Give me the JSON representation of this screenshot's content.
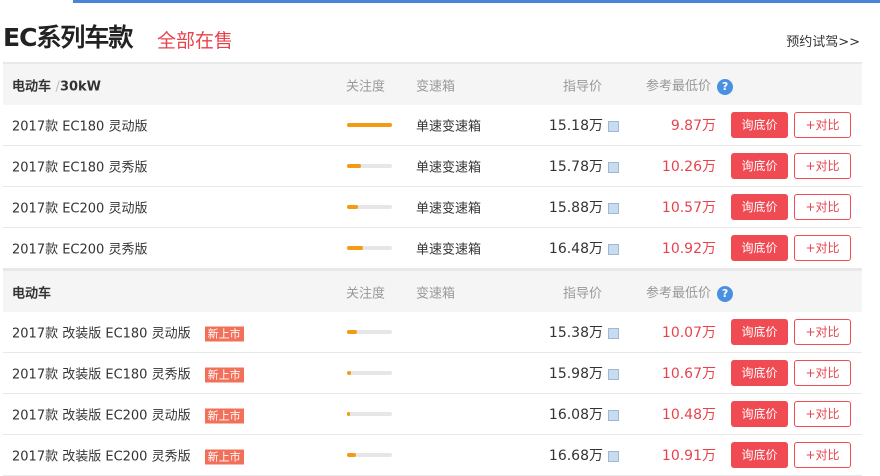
{
  "title": "EC系列车款",
  "tab": "全部在售",
  "test_drive": "预约试驾>>",
  "columns": {
    "attention": "关注度",
    "gearbox": "变速箱",
    "guide_price": "指导价",
    "lowest_price": "参考最低价",
    "help_icon": "?"
  },
  "buttons": {
    "inquire": "询底价",
    "compare": "+对比"
  },
  "badge_new": "新上市",
  "sections": [
    {
      "name": "电动车",
      "sep": "/",
      "power": "30kW",
      "rows": [
        {
          "name": "2017款 EC180 灵动版",
          "attention": 1.0,
          "gearbox": "单速变速箱",
          "guide": "15.18万",
          "low": "9.87万",
          "new": false
        },
        {
          "name": "2017款 EC180 灵秀版",
          "attention": 0.3,
          "gearbox": "单速变速箱",
          "guide": "15.78万",
          "low": "10.26万",
          "new": false
        },
        {
          "name": "2017款 EC200 灵动版",
          "attention": 0.25,
          "gearbox": "单速变速箱",
          "guide": "15.88万",
          "low": "10.57万",
          "new": false
        },
        {
          "name": "2017款 EC200 灵秀版",
          "attention": 0.35,
          "gearbox": "单速变速箱",
          "guide": "16.48万",
          "low": "10.92万",
          "new": false
        }
      ]
    },
    {
      "name": "电动车",
      "sep": "",
      "power": "",
      "rows": [
        {
          "name": "2017款 改装版 EC180 灵动版",
          "attention": 0.22,
          "gearbox": "",
          "guide": "15.38万",
          "low": "10.07万",
          "new": true
        },
        {
          "name": "2017款 改装版 EC180 灵秀版",
          "attention": 0.08,
          "gearbox": "",
          "guide": "15.98万",
          "low": "10.67万",
          "new": true
        },
        {
          "name": "2017款 改装版 EC200 灵动版",
          "attention": 0.06,
          "gearbox": "",
          "guide": "16.08万",
          "low": "10.48万",
          "new": true
        },
        {
          "name": "2017款 改装版 EC200 灵秀版",
          "attention": 0.2,
          "gearbox": "",
          "guide": "16.68万",
          "low": "10.91万",
          "new": true
        }
      ]
    }
  ]
}
